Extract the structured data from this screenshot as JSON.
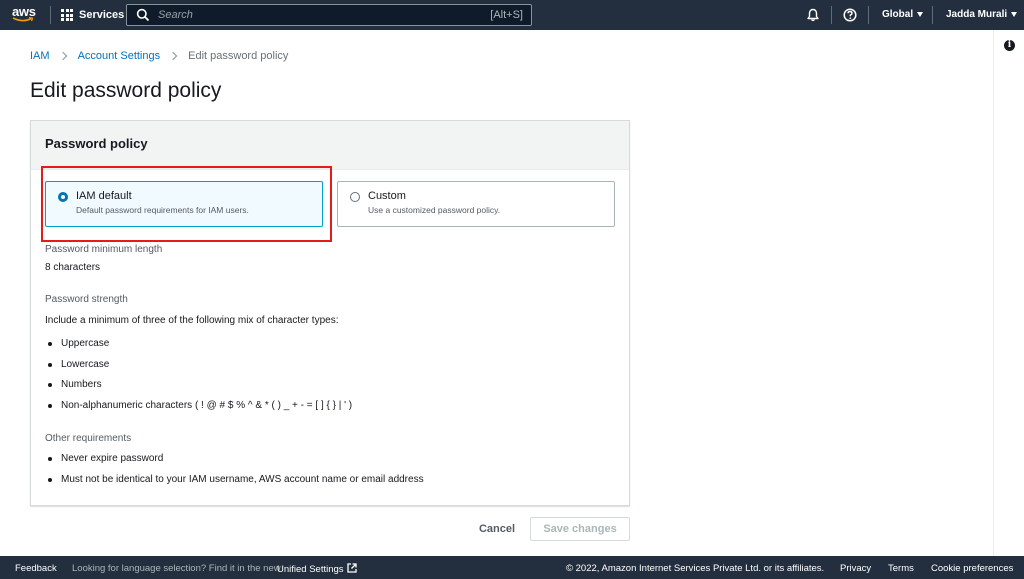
{
  "topnav": {
    "logo_text": "aws",
    "services_label": "Services",
    "search_placeholder": "Search",
    "search_shortcut": "[Alt+S]",
    "region_label": "Global",
    "user_label": "Jadda Murali",
    "icons": [
      "bell-icon",
      "help-icon",
      "search-icon",
      "grid-icon"
    ]
  },
  "breadcrumb": {
    "items": [
      "IAM",
      "Account Settings",
      "Edit password policy"
    ]
  },
  "page": {
    "title": "Edit password policy"
  },
  "panel": {
    "header": "Password policy",
    "options": [
      {
        "label": "IAM default",
        "description": "Default password requirements for IAM users.",
        "selected": true
      },
      {
        "label": "Custom",
        "description": "Use a customized password policy.",
        "selected": false
      }
    ],
    "min_length_label": "Password minimum length",
    "min_length_value": "8 characters",
    "strength_label": "Password strength",
    "strength_intro": "Include a minimum of three of the following mix of character types:",
    "strength_items": [
      "Uppercase",
      "Lowercase",
      "Numbers",
      "Non-alphanumeric characters ( ! @ # $ % ^ & * ( ) _ + - = [ ] { } | ' )"
    ],
    "other_label": "Other requirements",
    "other_items": [
      "Never expire password",
      "Must not be identical to your IAM username, AWS account name or email address"
    ]
  },
  "actions": {
    "cancel_label": "Cancel",
    "save_label": "Save changes"
  },
  "footer": {
    "feedback": "Feedback",
    "language_prompt": "Looking for language selection? Find it in the new",
    "unified_settings": "Unified Settings",
    "copyright": "© 2022, Amazon Internet Services Private Ltd. or its affiliates.",
    "privacy": "Privacy",
    "terms": "Terms",
    "cookie": "Cookie preferences"
  },
  "colors": {
    "nav_bg": "#232f3e",
    "link": "#0073bb",
    "selected_tile_bg": "#f1faff",
    "highlight_red": "#e41b17"
  }
}
